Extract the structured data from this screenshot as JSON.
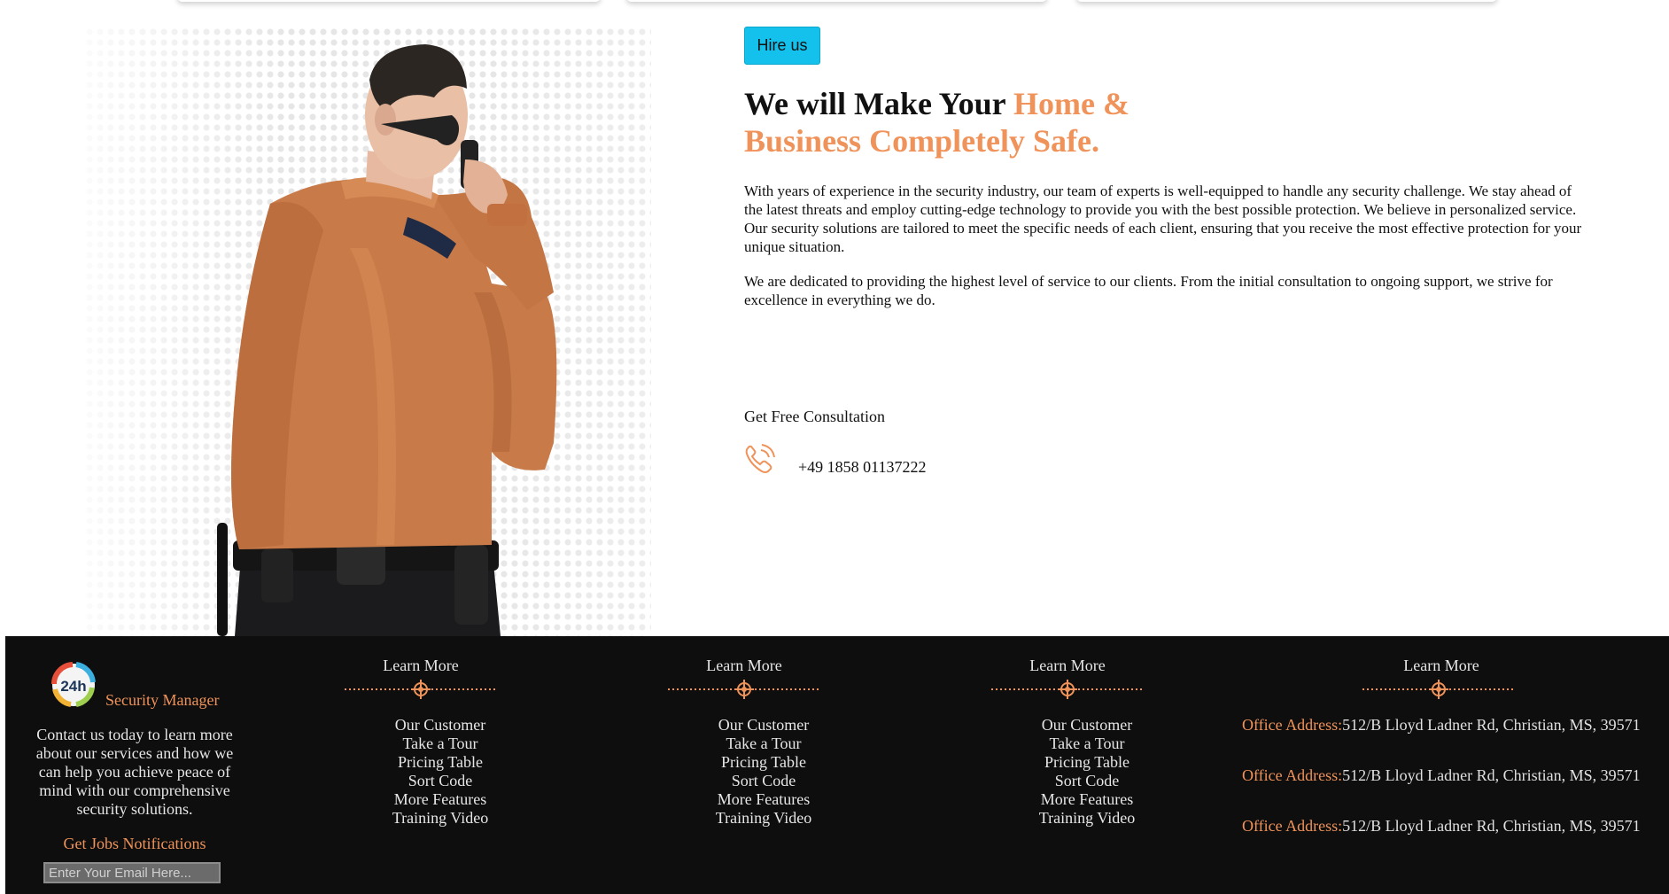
{
  "hero": {
    "hire_button": "Hire us",
    "headline_plain": "We will Make Your ",
    "headline_accent_1": "Home &",
    "headline_accent_2": "Business Completely Safe.",
    "paragraph_1": "With years of experience in the security industry, our team of experts is well-equipped to handle any security challenge. We stay ahead of the latest threats and employ cutting-edge technology to provide you with the best possible protection. We believe in personalized service. Our security solutions are tailored to meet the specific needs of each client, ensuring that you receive the most effective protection for your unique situation.",
    "paragraph_2": "We are dedicated to providing the highest level of service to our clients. From the initial consultation to ongoing support, we strive for excellence in everything we do.",
    "consultation_label": "Get Free Consultation",
    "phone": "+49 1858 01137222",
    "icon": "phone-icon"
  },
  "footer": {
    "brand": "Security Manager",
    "logo_badge": "24h",
    "about": "Contact us today to learn more about our services and how we can help you achieve peace of mind with our comprehensive security solutions.",
    "jobs_label": "Get Jobs Notifications",
    "email_placeholder": "Enter Your Email Here...",
    "columns": [
      {
        "title": "Learn More",
        "links": [
          "Our Customer",
          "Take a Tour",
          "Pricing Table",
          "Sort Code",
          "More Features",
          "Training Video"
        ]
      },
      {
        "title": "Learn More",
        "links": [
          "Our Customer",
          "Take a Tour",
          "Pricing Table",
          "Sort Code",
          "More Features",
          "Training Video"
        ]
      },
      {
        "title": "Learn More",
        "links": [
          "Our Customer",
          "Take a Tour",
          "Pricing Table",
          "Sort Code",
          "More Features",
          "Training Video"
        ]
      }
    ],
    "address_column": {
      "title": "Learn More",
      "items": [
        {
          "label": "Office Address:",
          "value": "512/B Lloyd Ladner Rd, Christian, MS, 39571"
        },
        {
          "label": "Office Address:",
          "value": "512/B Lloyd Ladner Rd, Christian, MS, 39571"
        },
        {
          "label": "Office Address:",
          "value": "512/B Lloyd Ladner Rd, Christian, MS, 39571"
        }
      ]
    }
  },
  "colors": {
    "accent": "#f0935a",
    "button": "#14c1ec",
    "footer_bg": "#0e0e0e"
  }
}
